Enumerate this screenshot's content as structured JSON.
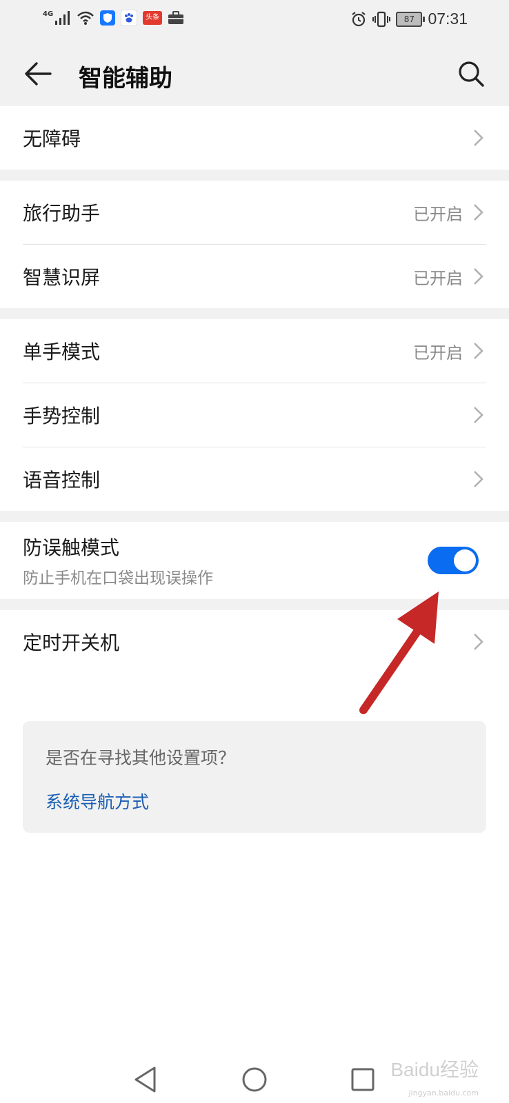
{
  "status_bar": {
    "network_label": "4G",
    "news_badge": "头条",
    "battery_level": "87",
    "time": "07:31",
    "icons": [
      "signal-icon",
      "wifi-icon",
      "shield-icon",
      "baidu-icon",
      "news-icon",
      "briefcase-icon",
      "alarm-icon",
      "vibrate-icon",
      "battery-icon"
    ]
  },
  "header": {
    "title": "智能辅助"
  },
  "groups": [
    {
      "items": [
        {
          "label": "无障碍",
          "status": ""
        }
      ]
    },
    {
      "items": [
        {
          "label": "旅行助手",
          "status": "已开启"
        },
        {
          "label": "智慧识屏",
          "status": "已开启"
        }
      ]
    },
    {
      "items": [
        {
          "label": "单手模式",
          "status": "已开启"
        },
        {
          "label": "手势控制",
          "status": ""
        },
        {
          "label": "语音控制",
          "status": ""
        }
      ]
    },
    {
      "items": [
        {
          "label": "防误触模式",
          "subtitle": "防止手机在口袋出现误操作",
          "toggle_on": true
        }
      ]
    },
    {
      "items": [
        {
          "label": "定时开关机",
          "status": ""
        }
      ]
    }
  ],
  "suggestion": {
    "question": "是否在寻找其他设置项？",
    "link": "系统导航方式"
  },
  "colors": {
    "accent": "#0a6cf0",
    "link": "#1a5fb4",
    "annotation_arrow": "#c62828"
  },
  "watermark": {
    "brand": "Baidu经验",
    "url": "jingyan.baidu.com"
  }
}
